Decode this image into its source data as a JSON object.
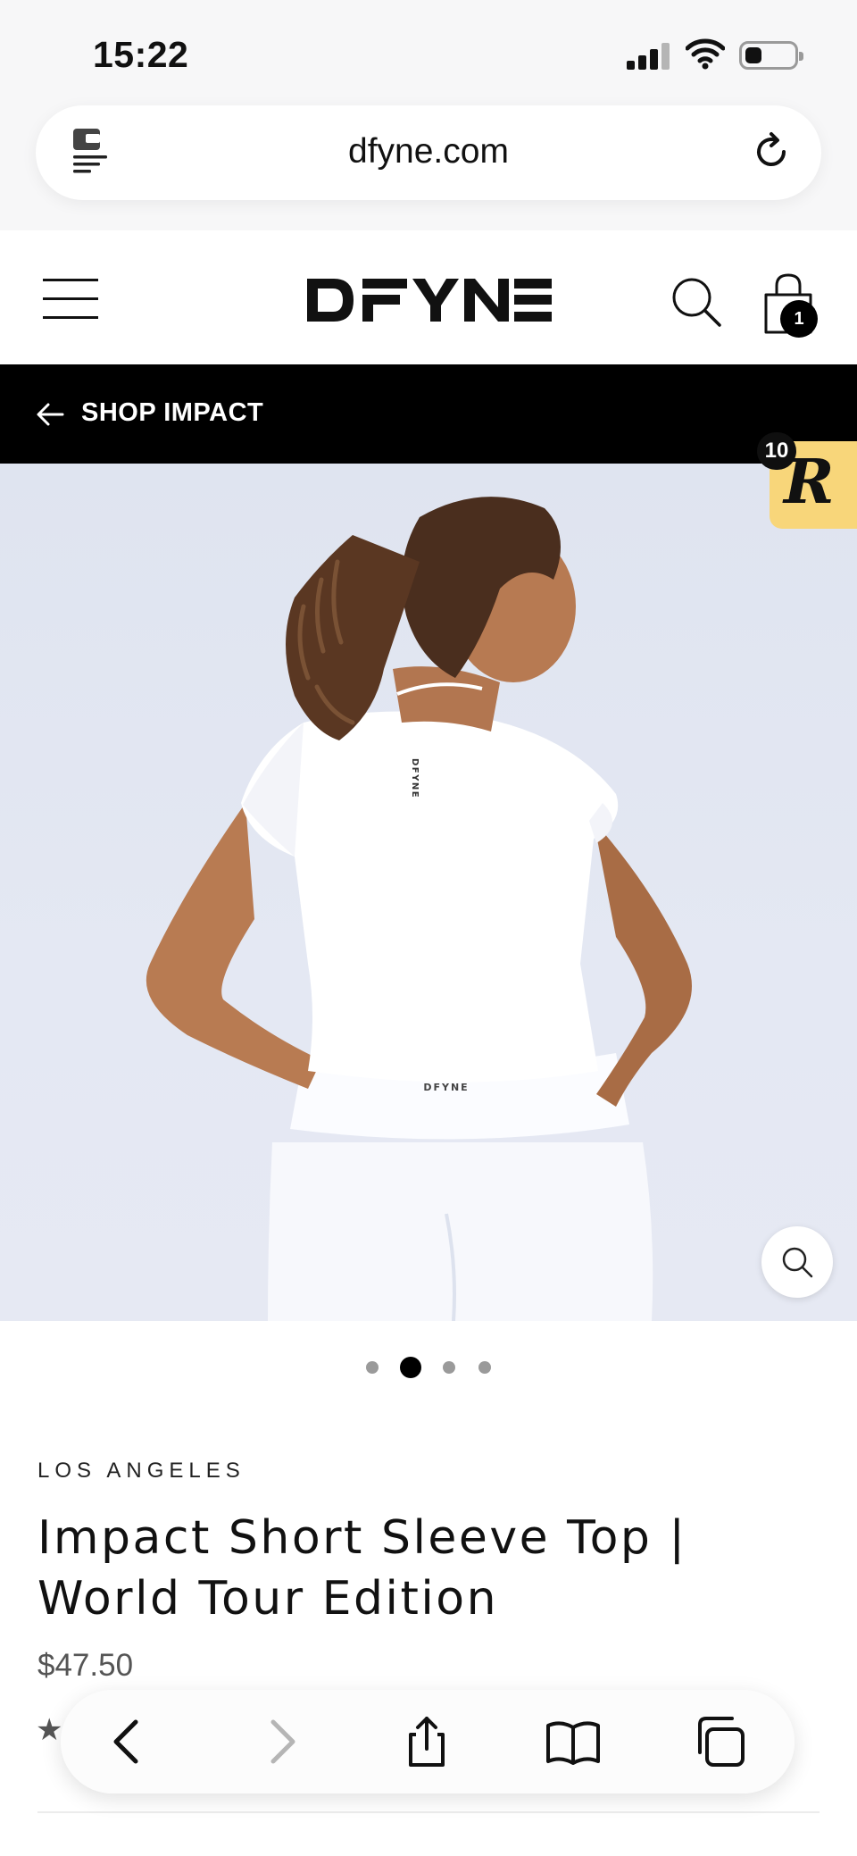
{
  "status_bar": {
    "time": "15:22"
  },
  "browser": {
    "url": "dfyne.com"
  },
  "header": {
    "logo_text": "DFYNE",
    "cart_count": "1"
  },
  "back_link": {
    "label": "SHOP IMPACT"
  },
  "rewards": {
    "count": "10",
    "letter": "R"
  },
  "gallery": {
    "total_images": 4,
    "active_index": 1
  },
  "product": {
    "brand": "LOS ANGELES",
    "title": "Impact Short Sleeve Top | World Tour Edition",
    "price": "$47.50"
  },
  "icons": {
    "status": [
      "signal-icon",
      "wifi-icon",
      "battery-icon"
    ],
    "address_bar": [
      "extension-icon",
      "reload-icon"
    ],
    "header": [
      "menu-icon",
      "search-icon",
      "cart-icon"
    ],
    "image": [
      "zoom-icon"
    ],
    "toolbar": [
      "back-icon",
      "forward-icon",
      "share-icon",
      "bookmarks-icon",
      "tabs-icon"
    ]
  },
  "colors": {
    "strip": "#000000",
    "rewards_badge": "#f8d67a",
    "image_bg": "#e2e6f2"
  }
}
